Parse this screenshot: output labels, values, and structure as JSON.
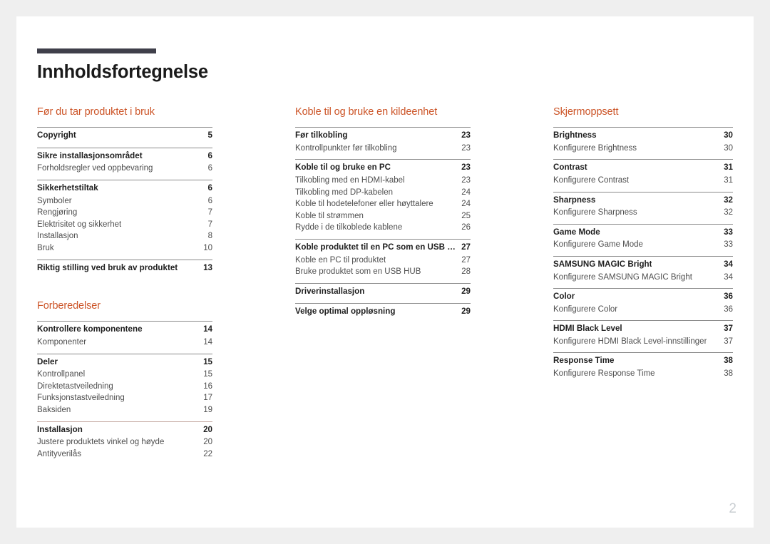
{
  "document": {
    "title": "Innholdsfortegnelse",
    "page_number": "2"
  },
  "colors": {
    "accent": "#cc5427",
    "title_rule": "#3f3f4a",
    "body_text": "#4e4e4e",
    "bold_text": "#1e1e1e",
    "page_background": "#ffffff",
    "canvas_background": "#efefef",
    "page_number": "#c9ced2"
  },
  "columns": [
    {
      "id": "column-1",
      "sections": [
        {
          "heading": "Før du tar produktet i bruk",
          "groups": [
            {
              "rule": "normal",
              "rows": [
                {
                  "type": "main",
                  "label": "Copyright",
                  "page": "5"
                }
              ]
            },
            {
              "rule": "normal",
              "rows": [
                {
                  "type": "main",
                  "label": "Sikre installasjonsområdet",
                  "page": "6"
                },
                {
                  "type": "sub",
                  "label": "Forholdsregler ved oppbevaring",
                  "page": "6"
                }
              ]
            },
            {
              "rule": "normal",
              "rows": [
                {
                  "type": "main",
                  "label": "Sikkerhetstiltak",
                  "page": "6"
                },
                {
                  "type": "sub",
                  "label": "Symboler",
                  "page": "6"
                },
                {
                  "type": "sub",
                  "label": "Rengjøring",
                  "page": "7"
                },
                {
                  "type": "sub",
                  "label": "Elektrisitet og sikkerhet",
                  "page": "7"
                },
                {
                  "type": "sub",
                  "label": "Installasjon",
                  "page": "8"
                },
                {
                  "type": "sub",
                  "label": "Bruk",
                  "page": "10"
                }
              ]
            },
            {
              "rule": "normal",
              "rows": [
                {
                  "type": "main",
                  "label": "Riktig stilling ved bruk av produktet",
                  "page": "13"
                }
              ]
            }
          ]
        },
        {
          "heading": "Forberedelser",
          "spaced": true,
          "groups": [
            {
              "rule": "normal",
              "rows": [
                {
                  "type": "main",
                  "label": "Kontrollere komponentene",
                  "page": "14"
                },
                {
                  "type": "sub",
                  "label": "Komponenter",
                  "page": "14"
                }
              ]
            },
            {
              "rule": "normal",
              "rows": [
                {
                  "type": "main",
                  "label": "Deler",
                  "page": "15"
                },
                {
                  "type": "sub",
                  "label": "Kontrollpanel",
                  "page": "15"
                },
                {
                  "type": "sub",
                  "label": "Direktetastveiledning",
                  "page": "16"
                },
                {
                  "type": "sub",
                  "label": "Funksjonstastveiledning",
                  "page": "17"
                },
                {
                  "type": "sub",
                  "label": "Baksiden",
                  "page": "19"
                }
              ]
            },
            {
              "rule": "soft",
              "rows": [
                {
                  "type": "main",
                  "label": "Installasjon",
                  "page": "20"
                },
                {
                  "type": "sub",
                  "label": "Justere produktets vinkel og høyde",
                  "page": "20"
                },
                {
                  "type": "sub",
                  "label": "Antityverilås",
                  "page": "22"
                }
              ]
            }
          ]
        }
      ]
    },
    {
      "id": "column-2",
      "sections": [
        {
          "heading": "Koble til og bruke en kildeenhet",
          "groups": [
            {
              "rule": "normal",
              "rows": [
                {
                  "type": "main",
                  "label": "Før tilkobling",
                  "page": "23"
                },
                {
                  "type": "sub",
                  "label": "Kontrollpunkter før tilkobling",
                  "page": "23"
                }
              ]
            },
            {
              "rule": "normal",
              "rows": [
                {
                  "type": "main",
                  "label": "Koble til og bruke en PC",
                  "page": "23"
                },
                {
                  "type": "sub",
                  "label": "Tilkobling med en HDMI-kabel",
                  "page": "23"
                },
                {
                  "type": "sub",
                  "label": "Tilkobling med DP-kabelen",
                  "page": "24"
                },
                {
                  "type": "sub",
                  "label": "Koble til hodetelefoner eller høyttalere",
                  "page": "24"
                },
                {
                  "type": "sub",
                  "label": "Koble til strømmen",
                  "page": "25"
                },
                {
                  "type": "sub",
                  "label": "Rydde i de tilkoblede kablene",
                  "page": "26"
                }
              ]
            },
            {
              "rule": "normal",
              "rows": [
                {
                  "type": "main",
                  "label": "Koble produktet til en PC som en USB HUB",
                  "page": "27"
                },
                {
                  "type": "sub",
                  "label": "Koble en PC til produktet",
                  "page": "27"
                },
                {
                  "type": "sub",
                  "label": "Bruke produktet som en USB HUB",
                  "page": "28"
                }
              ]
            },
            {
              "rule": "normal",
              "rows": [
                {
                  "type": "main",
                  "label": "Driverinstallasjon",
                  "page": "29"
                }
              ]
            },
            {
              "rule": "normal",
              "rows": [
                {
                  "type": "main",
                  "label": "Velge optimal oppløsning",
                  "page": "29"
                }
              ]
            }
          ]
        }
      ]
    },
    {
      "id": "column-3",
      "sections": [
        {
          "heading": "Skjermoppsett",
          "groups": [
            {
              "rule": "normal",
              "rows": [
                {
                  "type": "main",
                  "label": "Brightness",
                  "page": "30"
                },
                {
                  "type": "sub",
                  "label": "Konfigurere Brightness",
                  "page": "30"
                }
              ]
            },
            {
              "rule": "normal",
              "rows": [
                {
                  "type": "main",
                  "label": "Contrast",
                  "page": "31"
                },
                {
                  "type": "sub",
                  "label": "Konfigurere Contrast",
                  "page": "31"
                }
              ]
            },
            {
              "rule": "normal",
              "rows": [
                {
                  "type": "main",
                  "label": "Sharpness",
                  "page": "32"
                },
                {
                  "type": "sub",
                  "label": "Konfigurere Sharpness",
                  "page": "32"
                }
              ]
            },
            {
              "rule": "normal",
              "rows": [
                {
                  "type": "main",
                  "label": "Game Mode",
                  "page": "33"
                },
                {
                  "type": "sub",
                  "label": "Konfigurere Game Mode",
                  "page": "33"
                }
              ]
            },
            {
              "rule": "normal",
              "rows": [
                {
                  "type": "main",
                  "label": "SAMSUNG MAGIC Bright",
                  "page": "34"
                },
                {
                  "type": "sub",
                  "label": "Konfigurere SAMSUNG MAGIC Bright",
                  "page": "34"
                }
              ]
            },
            {
              "rule": "normal",
              "rows": [
                {
                  "type": "main",
                  "label": "Color",
                  "page": "36"
                },
                {
                  "type": "sub",
                  "label": "Konfigurere Color",
                  "page": "36"
                }
              ]
            },
            {
              "rule": "normal",
              "rows": [
                {
                  "type": "main",
                  "label": "HDMI Black Level",
                  "page": "37"
                },
                {
                  "type": "sub",
                  "label": "Konfigurere HDMI Black Level-innstillinger",
                  "page": "37"
                }
              ]
            },
            {
              "rule": "normal",
              "rows": [
                {
                  "type": "main",
                  "label": "Response Time",
                  "page": "38"
                },
                {
                  "type": "sub",
                  "label": "Konfigurere Response Time",
                  "page": "38"
                }
              ]
            }
          ]
        }
      ]
    }
  ]
}
